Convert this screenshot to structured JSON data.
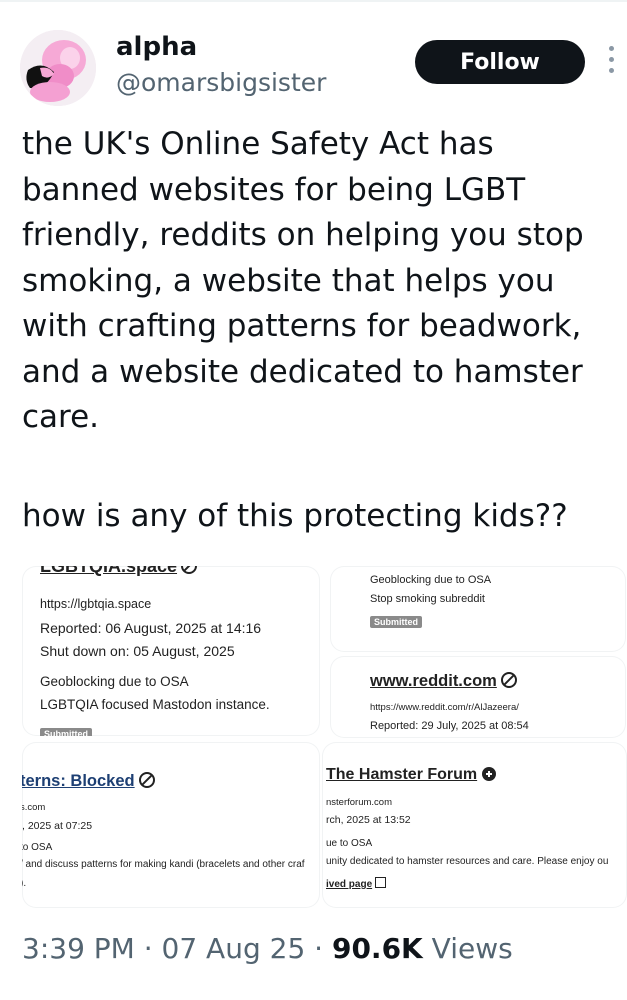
{
  "author": {
    "name": "alpha",
    "handle": "@omarsbigsister"
  },
  "follow_label": "Follow",
  "tweet": {
    "text": "the UK's Online Safety Act has\nbanned websites for being LGBT\nfriendly, reddits on helping you stop\nsmoking, a website that helps you\nwith crafting patterns for beadwork,\nand a website dedicated to hamster\ncare.",
    "question": "how is any of this protecting kids??"
  },
  "cards": {
    "lgbtqia": {
      "title": "LGBTQIA.space",
      "url": "https://lgbtqia.space",
      "reported": "Reported: 06 August, 2025 at 14:16",
      "shutdown": "Shut down on: 05 August, 2025",
      "reason": "Geoblocking due to OSA",
      "desc": "LGBTQIA focused Mastodon instance.",
      "badge": "Submitted"
    },
    "reddit_top": {
      "reason": "Geoblocking due to OSA",
      "desc": "Stop smoking subreddit",
      "badge": "Submitted"
    },
    "reddit": {
      "title": "www.reddit.com",
      "url": "https://www.reddit.com/r/AlJazeera/",
      "reported": "Reported: 29 July, 2025 at 08:54"
    },
    "patterns": {
      "title": "terns: Blocked",
      "url": "s.com",
      "reported": "', 2025 at 07:25",
      "reason": "to OSA",
      "desc": "/ and discuss patterns for making kandi (bracelets and other craf",
      "extra": ")."
    },
    "hamster": {
      "title": "The Hamster Forum",
      "url": "nsterforum.com",
      "reported": "rch, 2025 at 13:52",
      "reason": "ue to OSA",
      "desc": "unity dedicated to hamster resources and care. Please enjoy ou",
      "link": "ived page"
    }
  },
  "meta": {
    "time": "3:39 PM · 07 Aug 25 · ",
    "views_count": "90.6K",
    "views_label": " Views"
  }
}
